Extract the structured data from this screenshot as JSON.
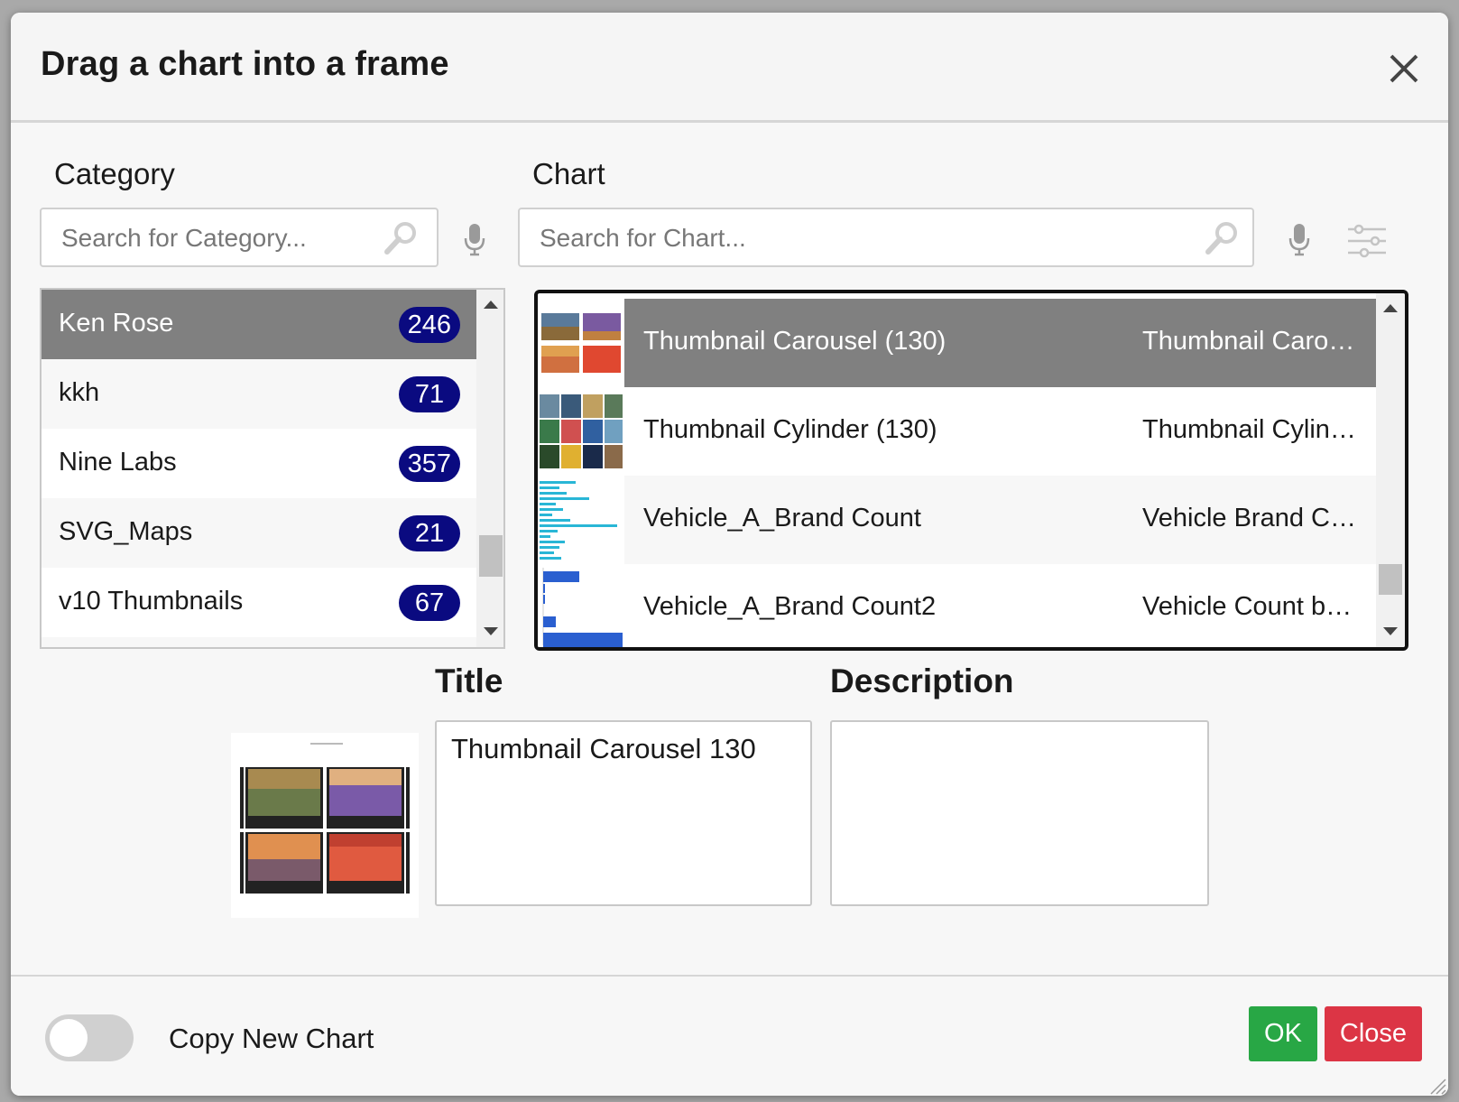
{
  "dialog": {
    "title": "Drag a chart into a frame"
  },
  "category": {
    "label": "Category",
    "search_placeholder": "Search for Category...",
    "items": [
      {
        "name": "Ken Rose",
        "count": "246"
      },
      {
        "name": "kkh",
        "count": "71"
      },
      {
        "name": "Nine Labs",
        "count": "357"
      },
      {
        "name": "SVG_Maps",
        "count": "21"
      },
      {
        "name": "v10 Thumbnails",
        "count": "67"
      }
    ],
    "selected": "Ken Rose"
  },
  "chart": {
    "label": "Chart",
    "search_placeholder": "Search for Chart...",
    "items": [
      {
        "name": "Thumbnail Carousel (130)",
        "title": "Thumbnail Caro…"
      },
      {
        "name": "Thumbnail Cylinder (130)",
        "title": "Thumbnail Cylin…"
      },
      {
        "name": "Vehicle_A_Brand Count",
        "title": "Vehicle Brand C…"
      },
      {
        "name": "Vehicle_A_Brand Count2",
        "title": "Vehicle Count b…"
      }
    ],
    "selected": "Thumbnail Carousel (130)"
  },
  "details": {
    "title_label": "Title",
    "title_value": "Thumbnail Carousel 130",
    "description_label": "Description",
    "description_value": ""
  },
  "footer": {
    "toggle_label": "Copy New Chart",
    "toggle_on": false,
    "ok_label": "OK",
    "close_label": "Close"
  },
  "colors": {
    "selected_row": "#808080",
    "badge": "#0a0a80",
    "ok": "#28a745",
    "close": "#dc3545"
  }
}
